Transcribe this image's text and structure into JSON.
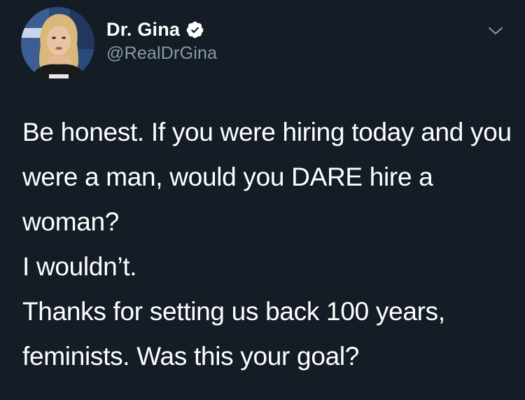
{
  "colors": {
    "background": "#141d26",
    "text_primary": "#ffffff",
    "text_secondary": "#8899a6",
    "verified_badge": "#ffffff"
  },
  "author": {
    "display_name": "Dr. Gina",
    "handle": "@RealDrGina",
    "verified": true,
    "avatar_icon": "profile-photo",
    "verified_icon": "verified-badge-icon"
  },
  "menu": {
    "icon": "chevron-down-icon"
  },
  "tweet": {
    "paragraphs": [
      "Be honest.  If you were hiring today and you were a man, would you DARE hire a woman?",
      "I wouldn’t.",
      "Thanks for setting us back 100 years, feminists. Was this your goal?"
    ]
  }
}
